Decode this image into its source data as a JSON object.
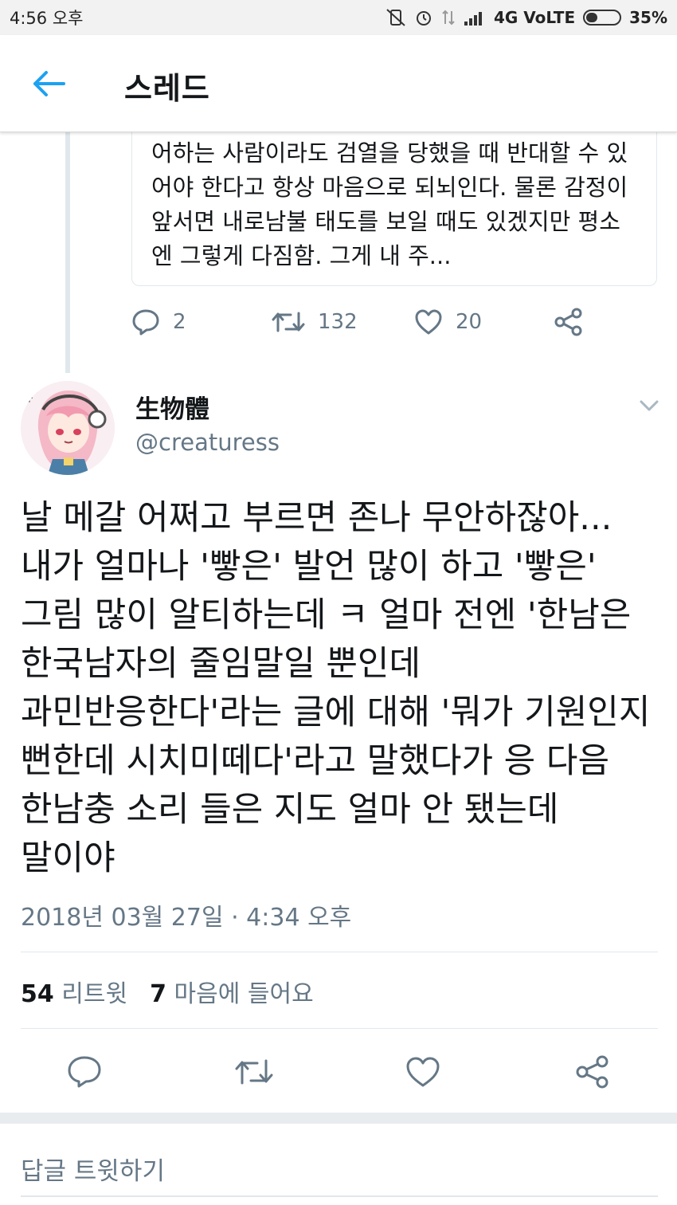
{
  "status_bar": {
    "time": "4:56 오후",
    "network": "4G VoLTE",
    "battery": "35%"
  },
  "header": {
    "title": "스레드"
  },
  "previous_tweet": {
    "quote_text": "어하는 사람이라도 검열을 당했을 때 반대할 수 있어야 한다고 항상 마음으로 되뇌인다. 물론 감정이 앞서면 내로남불 태도를 보일 때도 있겠지만 평소엔 그렇게 다짐함. 그게 내 주...",
    "replies": "2",
    "retweets": "132",
    "likes": "20"
  },
  "tweet": {
    "display_name": "生物體",
    "handle": "@creaturess",
    "text": "날 메갈 어쩌고 부르면 존나 무안하잖아... 내가 얼마나 '빻은' 발언 많이 하고 '빻은' 그림 많이 알티하는데 ㅋ 얼마 전엔 '한남은 한국남자의 줄임말일 뿐인데 과민반응한다'라는 글에 대해 '뭐가 기원인지 뻔한데 시치미떼다'라고 말했다가 응 다음 한남충 소리 들은 지도 얼마 안 됐는데 말이야",
    "timestamp": "2018년 03월 27일 · 4:34 오후",
    "retweet_count": "54",
    "retweet_label": "리트윗",
    "like_count": "7",
    "like_label": "마음에 들어요"
  },
  "reply_bar": {
    "placeholder": "답글 트윗하기"
  },
  "colors": {
    "accent": "#1da1f2",
    "muted": "#657786",
    "text": "#14171a",
    "border": "#e1e8ed"
  },
  "icons": [
    "back-arrow-icon",
    "reply-icon",
    "retweet-icon",
    "like-icon",
    "share-icon",
    "chevron-down-icon"
  ]
}
